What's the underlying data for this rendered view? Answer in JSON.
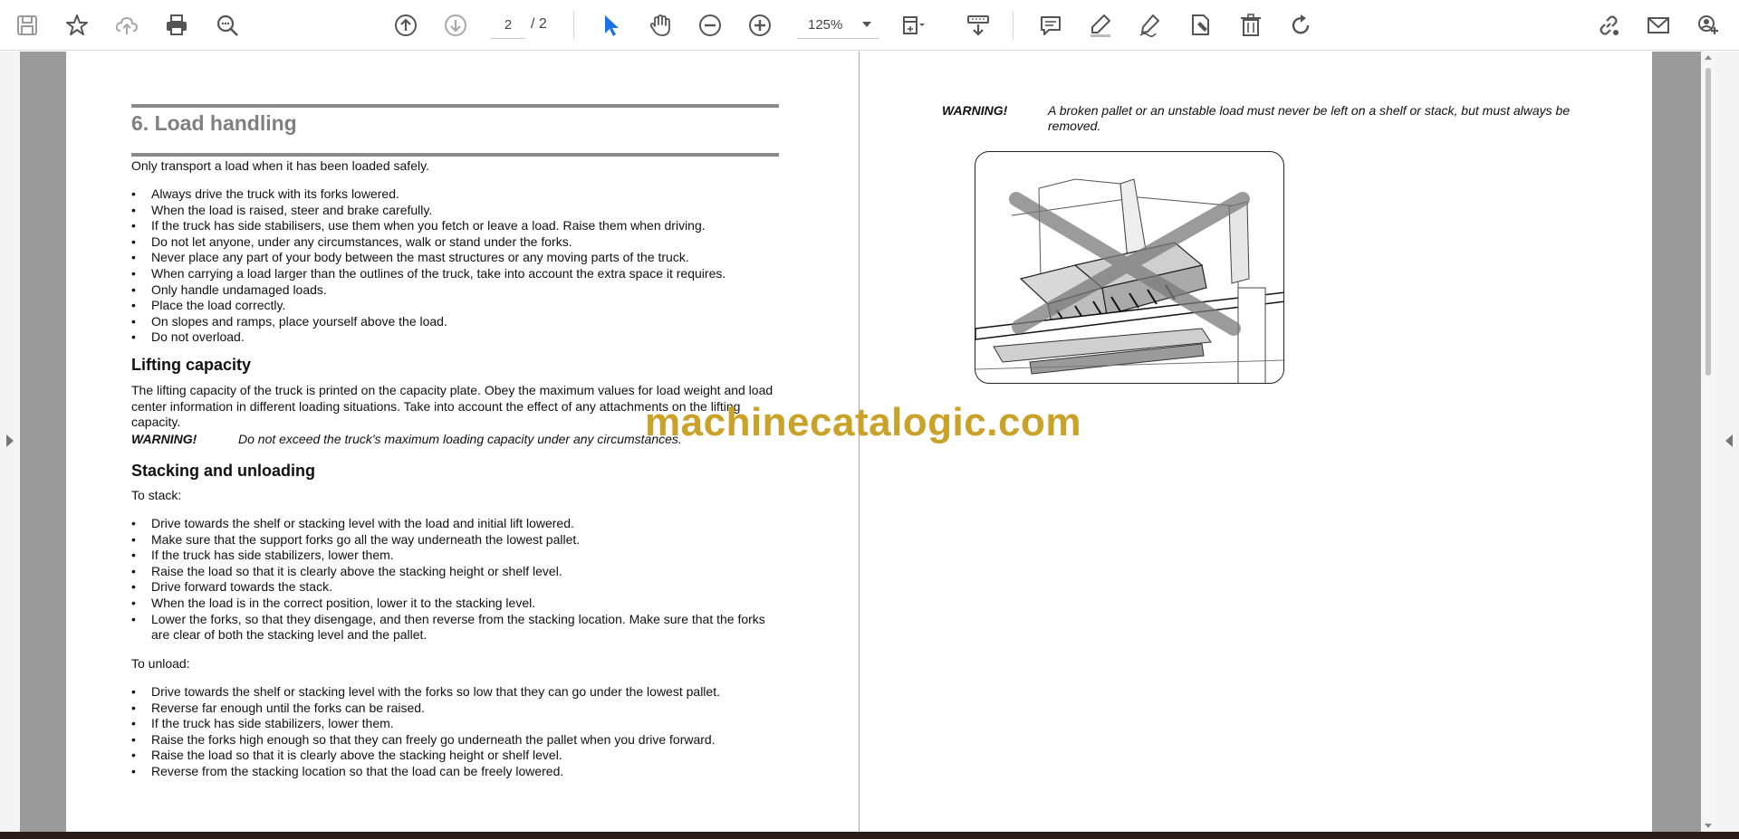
{
  "toolbar": {
    "icons": [
      "save-icon",
      "bookmark-star-icon",
      "cloud-upload-icon",
      "print-icon",
      "zoom-search-icon",
      "page-up-icon",
      "page-down-icon",
      "select-cursor-icon",
      "hand-pan-icon",
      "zoom-out-icon",
      "zoom-in-icon",
      "fit-page-icon",
      "scroll-mode-icon",
      "comment-icon",
      "highlight-pen-icon",
      "sign-pen-icon",
      "stamp-icon",
      "delete-trash-icon",
      "rotate-icon",
      "share-link-icon",
      "email-icon",
      "account-icon"
    ],
    "page_current": "2",
    "page_total": "/  2",
    "zoom": "125%"
  },
  "left_page": {
    "title": "6. Load handling",
    "intro": "Only transport a load when it has been loaded safely.",
    "bullets1": [
      "Always drive the truck with its forks lowered.",
      "When the load is raised, steer and brake carefully.",
      "If the truck has side stabilisers, use them when you fetch or leave a load. Raise them when driving.",
      "Do not let anyone, under any circumstances, walk or stand under the forks.",
      "Never place any part of your body between the mast structures or any moving parts of the truck.",
      "When carrying a load larger than the outlines of the truck, take into account the extra space it requires.",
      "Only handle undamaged loads.",
      "Place the load correctly.",
      "On slopes and ramps, place yourself above the load.",
      "Do not overload."
    ],
    "lifting_heading": "Lifting capacity",
    "lifting_text": "The lifting capacity of the truck is printed on the capacity plate. Obey the maximum values for load weight and load center information in different loading situations. Take into account the effect of any attachments on the lifting capacity.",
    "warning_label": "WARNING!",
    "warning_text": "Do not exceed the truck's maximum loading capacity under any circumstances.",
    "stacking_heading": "Stacking and unloading",
    "to_stack": "To stack:",
    "bullets_stack": [
      "Drive towards the shelf or stacking level with the load and initial lift lowered.",
      "Make sure that the support forks go all the way underneath the lowest pallet.",
      "If the truck has side stabilizers, lower them.",
      "Raise the load so that it is clearly above the stacking height or shelf level.",
      "Drive forward towards the stack.",
      "When the load is in the correct position, lower it to the stacking level.",
      "Lower the forks, so that they disengage, and then reverse from the stacking location. Make sure that the forks are clear of both the stacking level and the pallet."
    ],
    "to_unload": "To unload:",
    "bullets_unload": [
      "Drive towards the shelf or stacking level with the forks so low that they can go under the lowest pallet.",
      "Reverse far enough until the forks can be raised.",
      "If the truck has side stabilizers, lower them.",
      "Raise the forks high enough so that they can freely go underneath the pallet when you drive forward.",
      "Raise the load so that it is clearly above the stacking height or shelf level.",
      "Reverse from the stacking location so that the load can be freely lowered."
    ]
  },
  "right_page": {
    "warning_label": "WARNING!",
    "warning_text": "A broken pallet or an unstable load must never be left on a shelf or stack, but must always be removed."
  },
  "watermark": "machinecatalogic.com",
  "colors": {
    "accent_blue": "#1a73e8",
    "icon_gray": "#555555",
    "watermark": "#c9a227",
    "heading_gray": "#808080"
  }
}
